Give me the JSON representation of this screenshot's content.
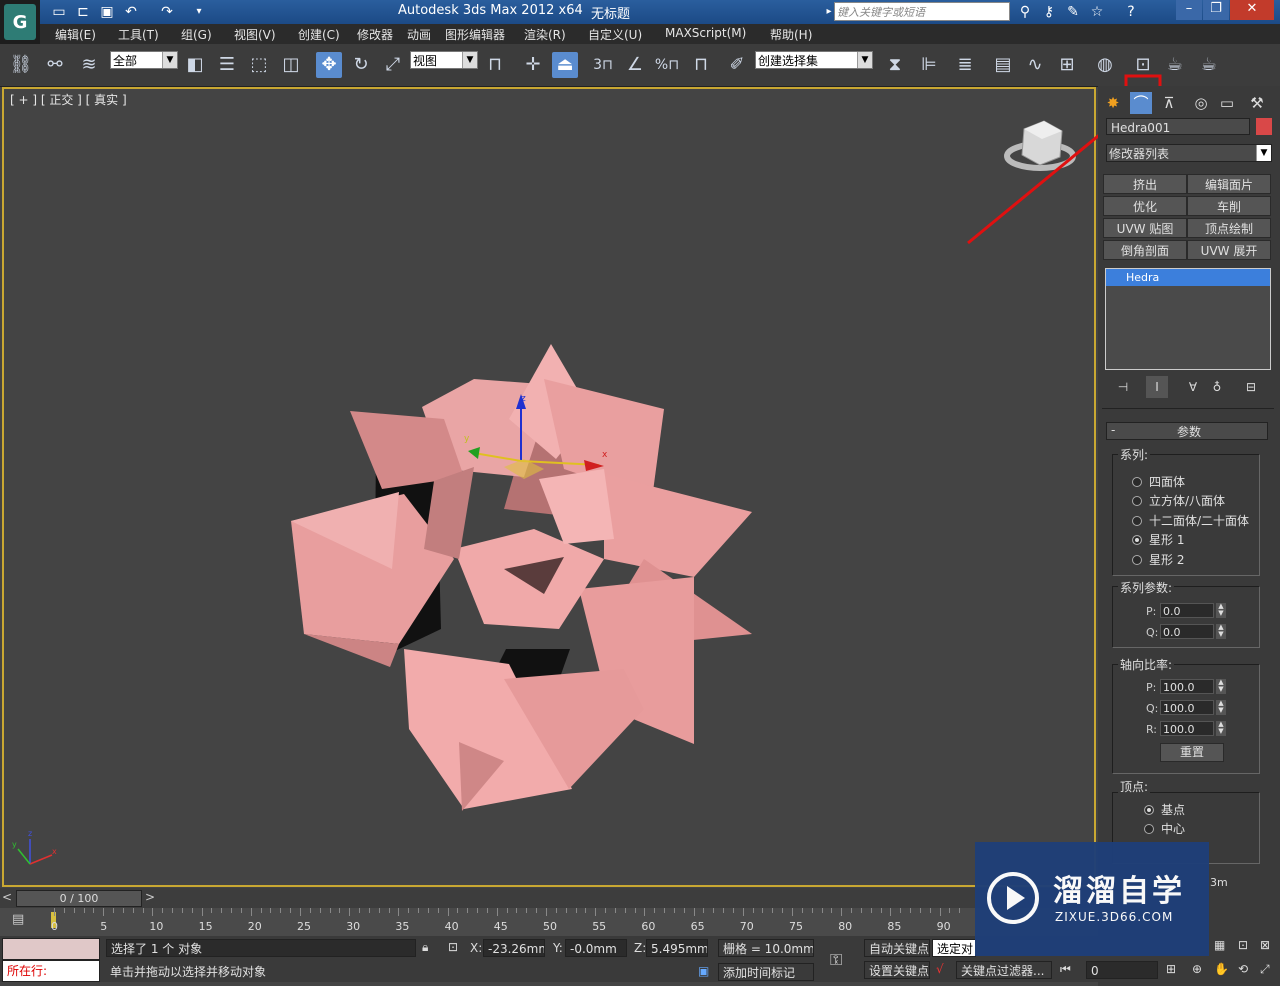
{
  "titlebar": {
    "app_title": "Autodesk 3ds Max  2012 x64",
    "doc_title": "无标题",
    "search_placeholder": "键入关键字或短语",
    "quick_icons": [
      "new-icon",
      "open-icon",
      "save-icon",
      "undo-icon",
      "redo-icon"
    ],
    "window_buttons": [
      "minimize-icon",
      "restore-icon",
      "close-icon"
    ]
  },
  "menubar": {
    "items": [
      "编辑(E)",
      "工具(T)",
      "组(G)",
      "视图(V)",
      "创建(C)",
      "修改器",
      "动画",
      "图形编辑器",
      "渲染(R)",
      "自定义(U)",
      "MAXScript(M)",
      "帮助(H)"
    ]
  },
  "toolbar": {
    "selection_filter": "全部",
    "ref_coord": "视图",
    "snap_labels": [
      "3",
      "%"
    ],
    "named_selection": "创建选择集"
  },
  "viewport": {
    "label": "[ + ] [ 正交 ] [ 真实 ]",
    "object_color": "#e59999",
    "axis_labels": {
      "x": "x",
      "y": "y",
      "z": "z"
    }
  },
  "command_panel": {
    "object_name": "Hedra001",
    "object_color": "#d94848",
    "modifier_list": "修改器列表",
    "buttons": [
      "挤出",
      "编辑面片",
      "优化",
      "车削",
      "UVW 贴图",
      "顶点绘制",
      "倒角剖面",
      "UVW 展开"
    ],
    "stack_item": "Hedra",
    "rollout_title": "参数",
    "family_title": "系列:",
    "family_options": [
      "四面体",
      "立方体/八面体",
      "十二面体/二十面体",
      "星形 1",
      "星形 2"
    ],
    "family_selected": 3,
    "family_params_title": "系列参数:",
    "family_params": [
      {
        "label": "P:",
        "value": "0.0"
      },
      {
        "label": "Q:",
        "value": "0.0"
      }
    ],
    "axis_scale_title": "轴向比率:",
    "axis_scale": [
      {
        "label": "P:",
        "value": "100.0"
      },
      {
        "label": "Q:",
        "value": "100.0"
      },
      {
        "label": "R:",
        "value": "100.0"
      }
    ],
    "reset_label": "重置",
    "vertices_title": "顶点:",
    "vertices_options": [
      "基点",
      "中心"
    ],
    "vertices_selected": 0,
    "radius_partial": "3m"
  },
  "timeline": {
    "frame_display": "0 / 100",
    "ticks": [
      "0",
      "5",
      "10",
      "15",
      "20",
      "25",
      "30",
      "35",
      "40",
      "45",
      "50",
      "55",
      "60",
      "65",
      "70",
      "75",
      "80",
      "85",
      "90"
    ]
  },
  "status": {
    "selected_text": "选择了 1 个 对象",
    "prompt_text": "单击并拖动以选择并移动对象",
    "maxscript_label": "所在行:",
    "x_label": "X:",
    "x_value": "-23.26mm",
    "y_label": "Y:",
    "y_value": "-0.0mm",
    "z_label": "Z:",
    "z_value": "5.495mm",
    "grid_text": "栅格 = 10.0mm",
    "add_time_tag": "添加时间标记",
    "auto_key": "自动关键点",
    "selected_obj": "选定对",
    "set_key": "设置关键点",
    "key_filters": "关键点过滤器...",
    "frame_value": "0"
  },
  "watermark": {
    "brand": "溜溜自学",
    "url": "ZIXUE.3D66.COM"
  }
}
